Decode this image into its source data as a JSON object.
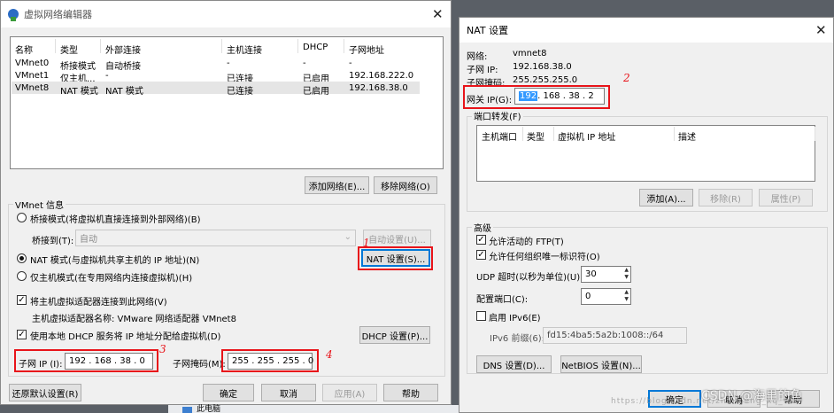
{
  "left": {
    "title": "虚拟网络编辑器",
    "table": {
      "headers": [
        "名称",
        "类型",
        "外部连接",
        "主机连接",
        "DHCP",
        "子网地址"
      ],
      "rows": [
        [
          "VMnet0",
          "桥接模式",
          "自动桥接",
          "-",
          "-",
          "-"
        ],
        [
          "VMnet1",
          "仅主机...",
          "-",
          "已连接",
          "已启用",
          "192.168.222.0"
        ],
        [
          "VMnet8",
          "NAT 模式",
          "NAT 模式",
          "已连接",
          "已启用",
          "192.168.38.0"
        ]
      ]
    },
    "add_network": "添加网络(E)...",
    "remove_network": "移除网络(O)",
    "vmnet_info": "VMnet 信息",
    "bridged_mode": "桥接模式(将虚拟机直接连接到外部网络)(B)",
    "bridged_to_label": "桥接到(T):",
    "bridged_to_value": "自动",
    "auto_settings": "自动设置(U)...",
    "nat_mode": "NAT 模式(与虚拟机共享主机的 IP 地址)(N)",
    "nat_settings": "NAT 设置(S)...",
    "host_only": "仅主机模式(在专用网络内连接虚拟机)(H)",
    "connect_adapter": "将主机虚拟适配器连接到此网络(V)",
    "adapter_name": "主机虚拟适配器名称: VMware 网络适配器 VMnet8",
    "use_dhcp": "使用本地 DHCP 服务将 IP 地址分配给虚拟机(D)",
    "dhcp_settings": "DHCP 设置(P)...",
    "subnet_ip_label": "子网 IP (I):",
    "subnet_ip": "192 . 168 . 38 . 0",
    "subnet_mask_label": "子网掩码(M):",
    "subnet_mask": "255 . 255 . 255 . 0",
    "restore_defaults": "还原默认设置(R)",
    "ok": "确定",
    "cancel": "取消",
    "apply": "应用(A)",
    "help": "帮助",
    "annotations": [
      "1",
      "3",
      "4"
    ]
  },
  "right": {
    "title": "NAT 设置",
    "network_label": "网络:",
    "network_value": "vmnet8",
    "subnet_ip_label": "子网 IP:",
    "subnet_ip_value": "192.168.38.0",
    "subnet_mask_label": "子网掩码:",
    "subnet_mask_value": "255.255.255.0",
    "gateway_label": "网关 IP(G):",
    "gateway_selected": "192",
    "gateway_rest": " . 168 . 38 . 2",
    "port_forwarding": "端口转发(F)",
    "pf_headers": [
      "主机端口",
      "类型",
      "虚拟机 IP 地址",
      "描述"
    ],
    "add": "添加(A)...",
    "remove": "移除(R)",
    "properties": "属性(P)",
    "advanced": "高级",
    "allow_ftp": "允许活动的 FTP(T)",
    "allow_oui": "允许任何组织唯一标识符(O)",
    "udp_timeout_label": "UDP 超时(以秒为单位)(U):",
    "udp_timeout": "30",
    "config_port_label": "配置端口(C):",
    "config_port": "0",
    "enable_ipv6": "启用 IPv6(E)",
    "ipv6_prefix_label": "IPv6 前缀(6):",
    "ipv6_prefix": "fd15:4ba5:5a2b:1008::/64",
    "dns_settings": "DNS 设置(D)...",
    "netbios_settings": "NetBIOS 设置(N)...",
    "ok": "确定",
    "cancel": "取消",
    "help": "帮助",
    "annotation": "2"
  },
  "watermark": "https://blog.csdn.net/zhangeng_xq_wa",
  "watermark_logo": "CSDN @海里的鱼",
  "taskbar_item": "此电脑",
  "colors": {
    "annotation_red": "#e8141a",
    "selection_blue": "#3399ff",
    "default_button_border": "#0078d7"
  }
}
